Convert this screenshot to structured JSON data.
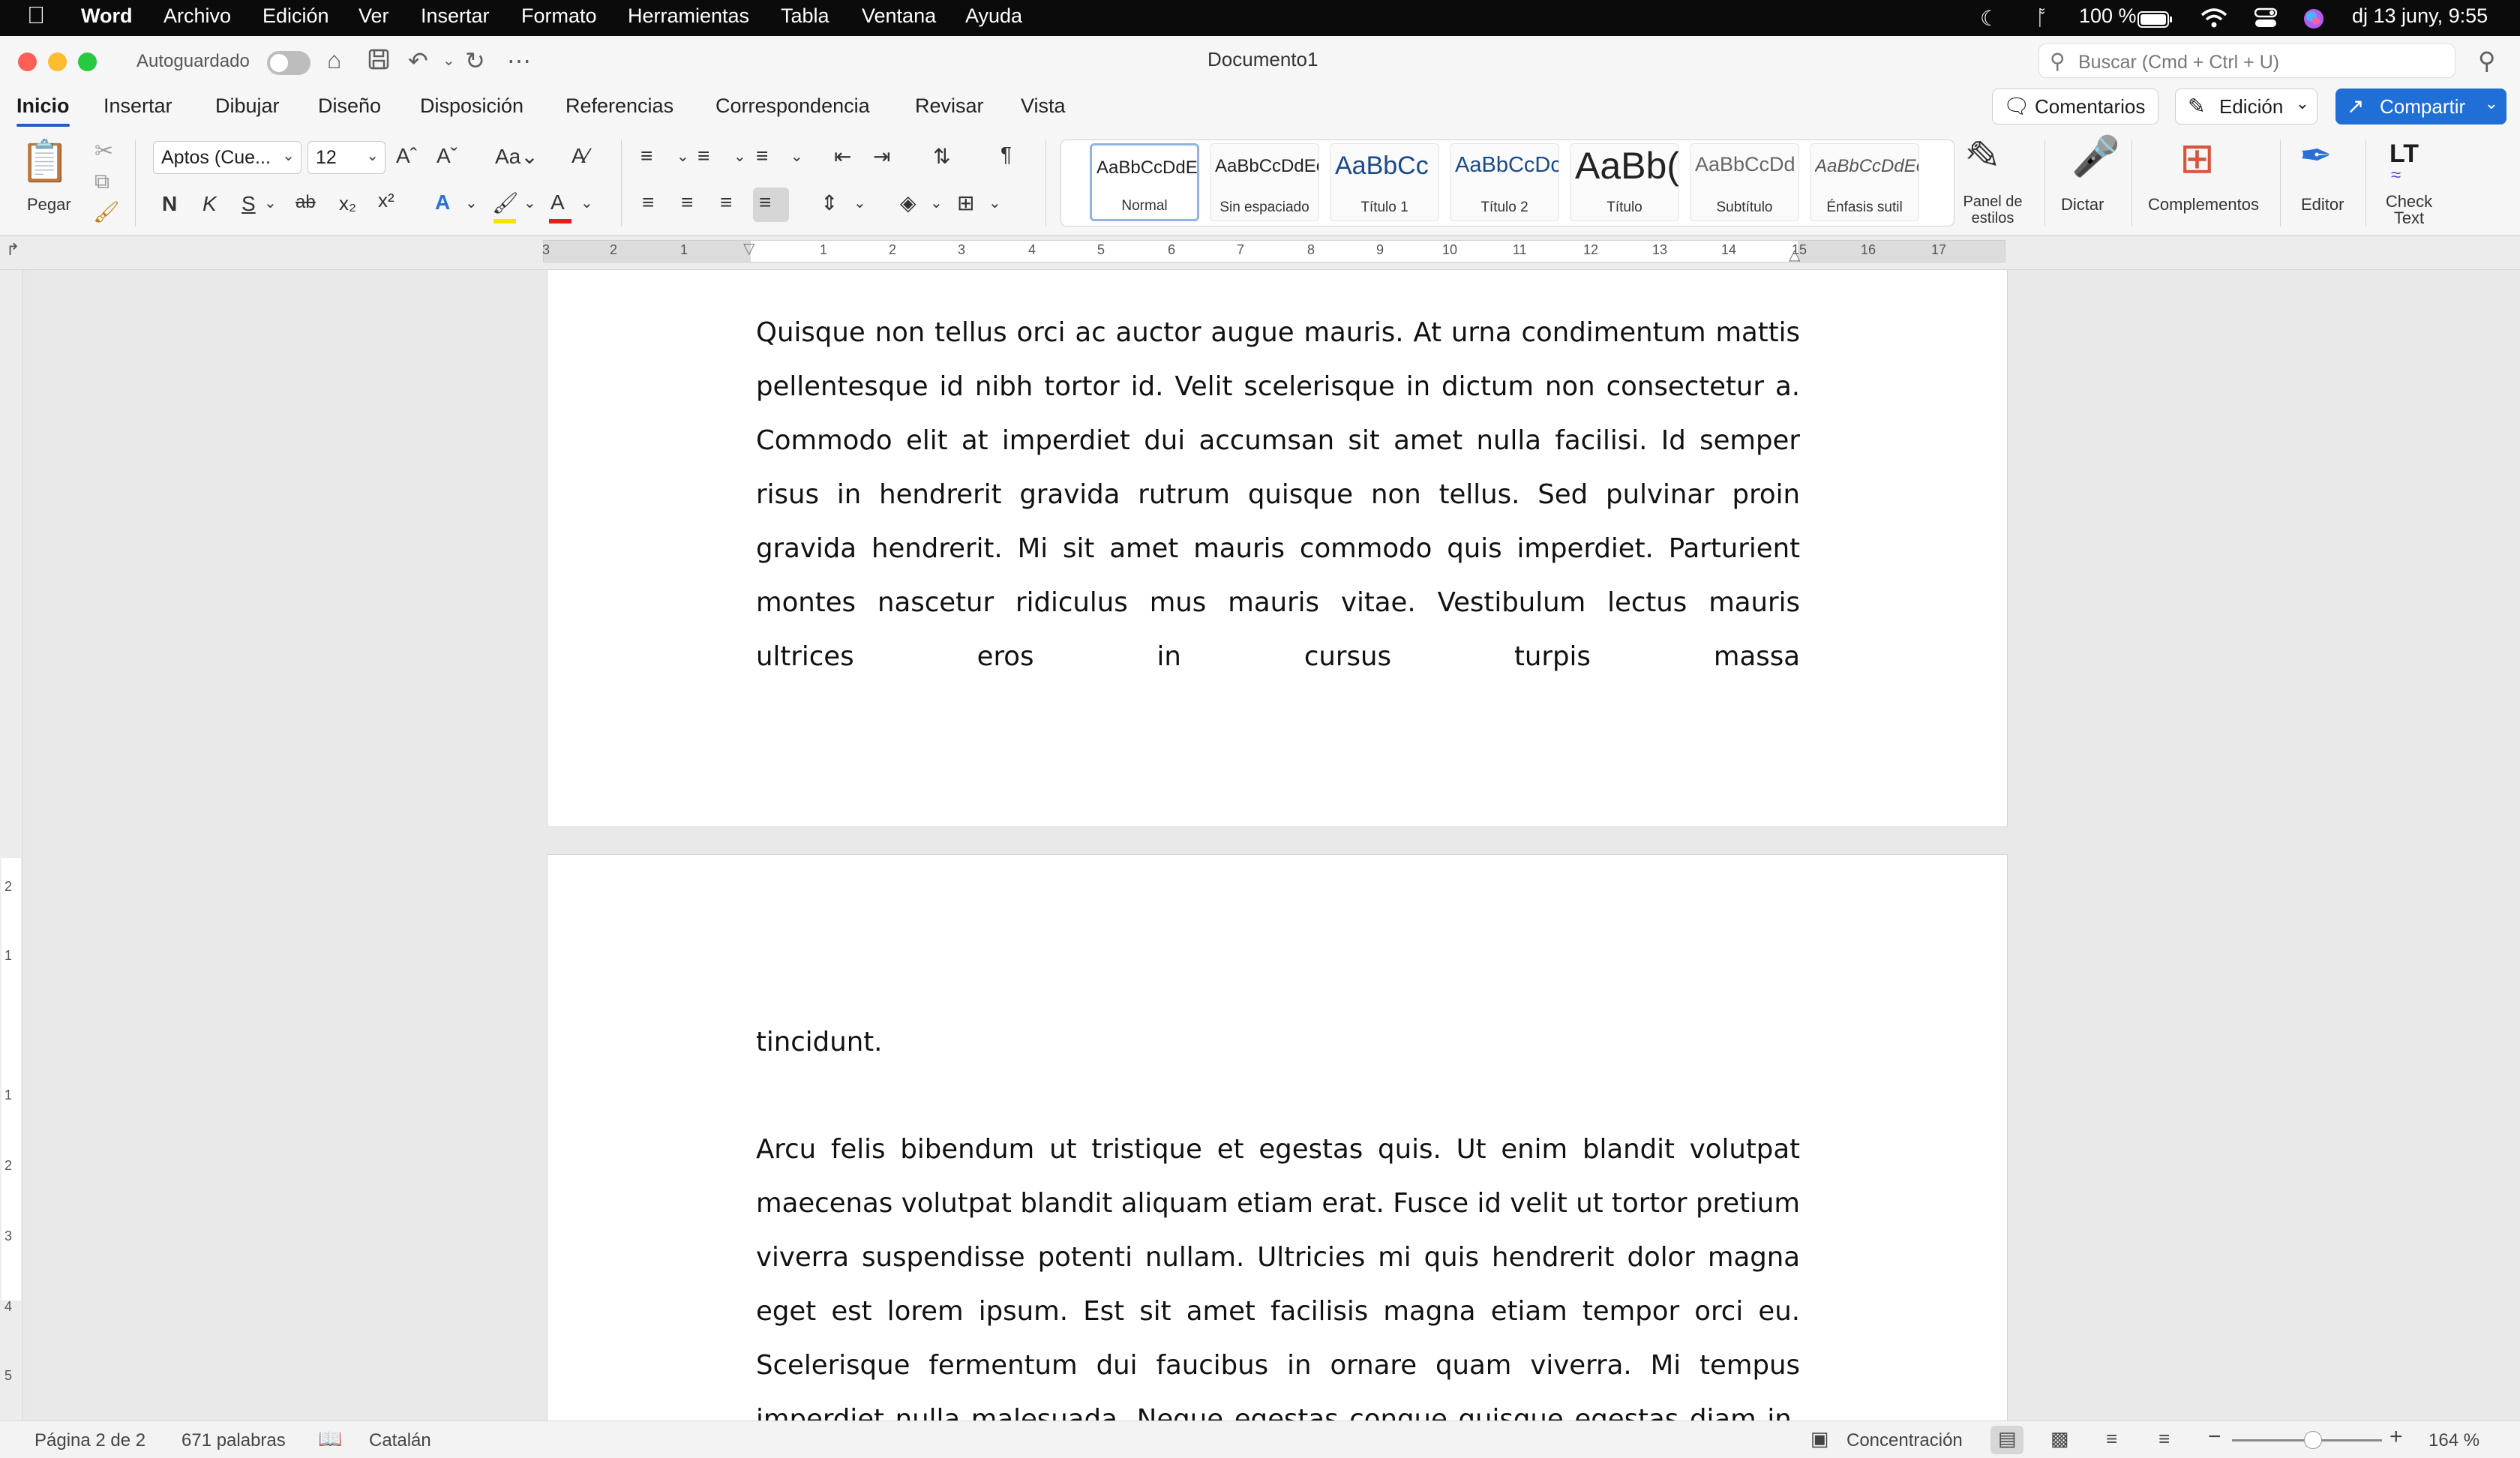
{
  "menubar": {
    "app": "Word",
    "items": [
      "Archivo",
      "Edición",
      "Ver",
      "Insertar",
      "Formato",
      "Herramientas",
      "Tabla",
      "Ventana",
      "Ayuda"
    ],
    "battery": "100 %",
    "datetime": "dj 13 juny, 9:55"
  },
  "titlebar": {
    "autosave_label": "Autoguardado",
    "doc_title": "Documento1",
    "search_placeholder": "Buscar (Cmd + Ctrl + U)"
  },
  "tabs": {
    "items": [
      "Inicio",
      "Insertar",
      "Dibujar",
      "Diseño",
      "Disposición",
      "Referencias",
      "Correspondencia",
      "Revisar",
      "Vista"
    ],
    "active": "Inicio",
    "comments": "Comentarios",
    "editing": "Edición",
    "share": "Compartir"
  },
  "ribbon": {
    "paste": "Pegar",
    "font_name": "Aptos (Cue...",
    "font_size": "12",
    "bold": "N",
    "italic": "K",
    "underline": "S",
    "strike": "ab",
    "styles": [
      {
        "preview": "AaBbCcDdEe",
        "name": "Normal"
      },
      {
        "preview": "AaBbCcDdEe",
        "name": "Sin espaciado"
      },
      {
        "preview": "AaBbCc",
        "name": "Título 1"
      },
      {
        "preview": "AaBbCcDc",
        "name": "Título 2"
      },
      {
        "preview": "AaBb(",
        "name": "Título"
      },
      {
        "preview": "AaBbCcDd",
        "name": "Subtítulo"
      },
      {
        "preview": "AaBbCcDdEe",
        "name": "Énfasis sutil"
      }
    ],
    "styles_pane": "Panel de estilos",
    "dictate": "Dictar",
    "addins": "Complementos",
    "editor": "Editor",
    "check_text": "Check Text",
    "check_text_logo": "LT"
  },
  "document": {
    "page1_paragraph": "Quisque non tellus orci ac auctor augue mauris. At urna condimentum mattis pellentesque id nibh tortor id. Velit scelerisque in dictum non consectetur a. Commodo elit at imperdiet dui accumsan sit amet nulla facilisi. Id semper risus in hendrerit gravida rutrum quisque non tellus. Sed pulvinar proin gravida hendrerit. Mi sit amet mauris commodo quis imperdiet. Parturient montes nascetur ridiculus mus mauris vitae. Vestibulum lectus mauris ultrices eros in cursus turpis massa",
    "page2_continuation": "tincidunt.",
    "page2_paragraph": "Arcu felis bibendum ut tristique et egestas quis. Ut enim blandit volutpat maecenas volutpat blandit aliquam etiam erat. Fusce id velit ut tortor pretium viverra suspendisse potenti nullam. Ultricies mi quis hendrerit dolor magna eget est lorem ipsum. Est sit amet facilisis magna etiam tempor orci eu. Scelerisque fermentum dui faucibus in ornare quam viverra. Mi tempus imperdiet nulla malesuada. Neque egestas congue quisque egestas diam in. Volutpat consequat mauris nunc congue"
  },
  "statusbar": {
    "page": "Página 2 de 2",
    "words": "671 palabras",
    "language": "Catalán",
    "focus": "Concentración",
    "zoom": "164 %",
    "zoom_level_percent": 164
  },
  "colors": {
    "accent": "#1f6fd6",
    "close": "#ff5f57",
    "minimize": "#febc2e",
    "maximize": "#28c840"
  },
  "ruler_numbers": {
    "horizontal": [
      "3",
      "2",
      "1",
      "1",
      "2",
      "3",
      "4",
      "5",
      "6",
      "7",
      "8",
      "9",
      "10",
      "11",
      "12",
      "13",
      "14",
      "15",
      "16",
      "17"
    ],
    "vertical": [
      "2",
      "1",
      "1",
      "2",
      "3",
      "4",
      "5"
    ]
  }
}
